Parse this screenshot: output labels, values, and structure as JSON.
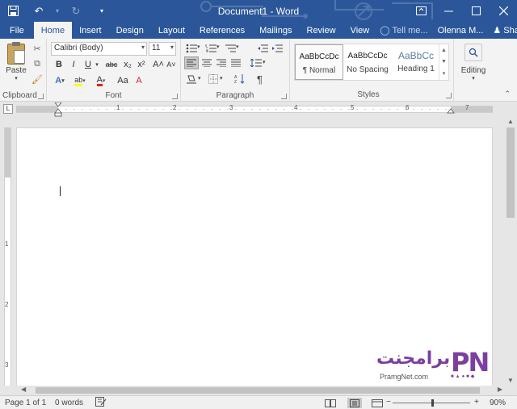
{
  "titlebar": {
    "title": "Document1 - Word",
    "qat": {
      "save_icon": "save-icon",
      "undo_icon": "undo-icon",
      "redo_icon": "redo-icon",
      "more_icon": "customize-qat-icon"
    },
    "window_buttons": {
      "ribbon_display": "ribbon-display-options-icon",
      "minimize": "minimize-icon",
      "maximize": "maximize-icon",
      "close": "close-icon"
    }
  },
  "tabs": {
    "file": "File",
    "items": [
      "Home",
      "Insert",
      "Design",
      "Layout",
      "References",
      "Mailings",
      "Review",
      "View"
    ],
    "active": "Home",
    "tell_me": "Tell me...",
    "user": "Olenna M...",
    "share": "Share"
  },
  "ribbon": {
    "clipboard": {
      "label": "Clipboard",
      "paste": "Paste"
    },
    "font": {
      "label": "Font",
      "font_name": "Calibri (Body)",
      "font_size": "11",
      "buttons": {
        "bold": "B",
        "italic": "I",
        "underline": "U",
        "strike": "abc",
        "subscript": "x₂",
        "superscript": "x²",
        "grow": "A˄",
        "shrink": "A˅",
        "case": "Aa",
        "clear": "A",
        "effects": "A",
        "highlight": "ab",
        "color": "A"
      }
    },
    "paragraph": {
      "label": "Paragraph",
      "pilcrow": "¶"
    },
    "styles": {
      "label": "Styles",
      "items": [
        {
          "preview": "AaBbCcDc",
          "name": "¶ Normal"
        },
        {
          "preview": "AaBbCcDc",
          "name": "No Spacing"
        },
        {
          "preview": "AaBbCc",
          "name": "Heading 1"
        }
      ]
    },
    "editing": {
      "label": "Editing"
    }
  },
  "ruler": {
    "tab_selector": "L",
    "labels": [
      "1",
      "1",
      "2",
      "3",
      "4",
      "5",
      "6",
      "7"
    ]
  },
  "status": {
    "page": "Page 1 of 1",
    "words": "0 words",
    "zoom": "90%",
    "zoom_minus": "−",
    "zoom_plus": "+"
  },
  "watermark": {
    "arabic": "برامجنت",
    "logo": "PN",
    "url": "PramgNet.com"
  },
  "colors": {
    "accent": "#2b579a",
    "watermark": "#7b3fa0"
  }
}
